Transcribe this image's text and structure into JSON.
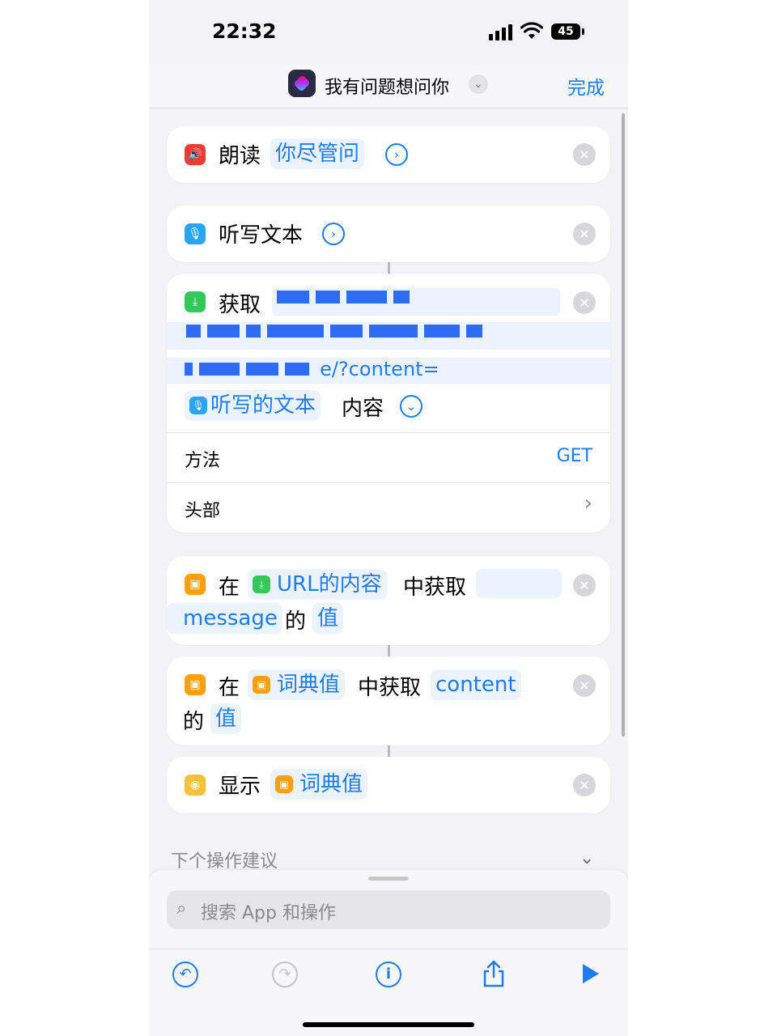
{
  "status": {
    "time": "22:32",
    "battery": "45"
  },
  "nav": {
    "title": "我有问题想问你",
    "done_label": "完成"
  },
  "actions": {
    "speak": {
      "verb": "朗读",
      "token": "你尽管问"
    },
    "dictate": {
      "verb": "听写文本"
    },
    "get": {
      "verb": "获取",
      "url_tail": "e/?content=",
      "var_token": "听写的文本",
      "content_word": "内容",
      "method_label": "方法",
      "method_value": "GET",
      "headers_label": "头部"
    },
    "dict1": {
      "in_word": "在",
      "token": "URL的内容",
      "get_word": "中获取",
      "key_token": "message",
      "of_word": "的",
      "value_token": "值"
    },
    "dict2": {
      "in_word": "在",
      "token": "词典值",
      "get_word": "中获取",
      "key_token": "content",
      "of_word": "的",
      "value_token": "值"
    },
    "show": {
      "verb": "显示",
      "token": "词典值"
    }
  },
  "suggestions": {
    "label": "下个操作建议"
  },
  "search": {
    "placeholder": "搜索 App 和操作"
  },
  "colors": {
    "accent": "#1e7cf2",
    "speak": "#ef3b36",
    "dictate": "#2aa4f4",
    "get": "#34c759",
    "dict": "#ff9f0a",
    "show": "#f7c23a"
  },
  "icons": {
    "speak": "speaker-icon",
    "dictate": "microphone-icon",
    "get": "download-icon",
    "dict": "dictionary-icon",
    "show": "quicklook-icon",
    "toolbar": [
      "undo-icon",
      "redo-icon",
      "info-icon",
      "share-icon",
      "play-icon"
    ]
  }
}
